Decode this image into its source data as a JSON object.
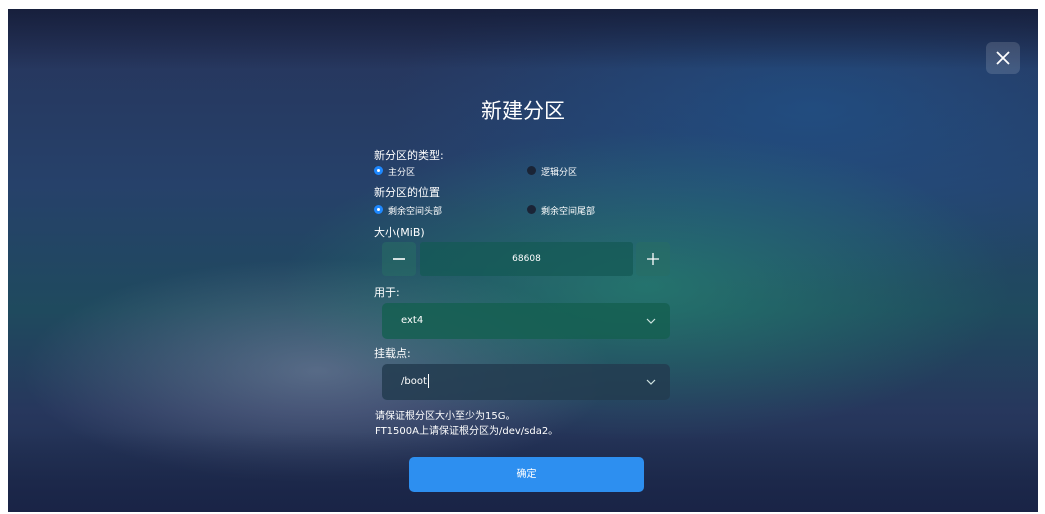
{
  "dialog": {
    "title": "新建分区",
    "type_label": "新分区的类型:",
    "type_options": [
      "主分区",
      "逻辑分区"
    ],
    "type_selected": "主分区",
    "position_label": "新分区的位置",
    "position_options": [
      "剩余空间头部",
      "剩余空间尾部"
    ],
    "position_selected": "剩余空间头部",
    "size_label": "大小(MiB)",
    "size_value": "68608",
    "fs_label": "用于:",
    "fs_value": "ext4",
    "mount_label": "挂载点:",
    "mount_value": "/boot",
    "note_line1": "请保证根分区大小至少为15G。",
    "note_line2": "FT1500A上请保证根分区为/dev/sda2。",
    "confirm_label": "确定"
  },
  "icons": {
    "close": "close-icon",
    "minus": "minus-icon",
    "plus": "plus-icon",
    "dropdown": "chevron-down-icon"
  },
  "colors": {
    "accent": "#2d8ff0",
    "radio_selected": "#1e88ff"
  }
}
